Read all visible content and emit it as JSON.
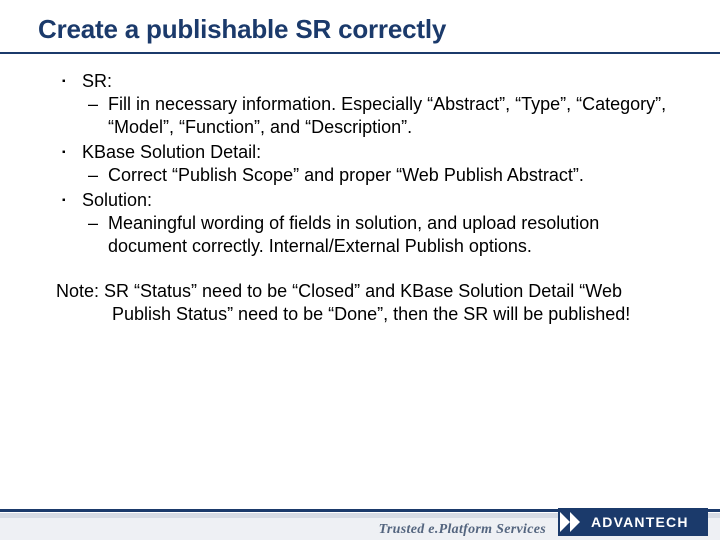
{
  "title": "Create a publishable SR correctly",
  "bullets": [
    {
      "label": "SR:",
      "sub": [
        "Fill in necessary information. Especially “Abstract”, “Type”, “Category”, “Model”, “Function”, and “Description”."
      ]
    },
    {
      "label": "KBase Solution Detail:",
      "sub": [
        "Correct “Publish Scope” and proper “Web Publish Abstract”."
      ]
    },
    {
      "label": "Solution:",
      "sub": [
        "Meaningful wording of fields in solution, and upload resolution document correctly. Internal/External Publish options."
      ]
    }
  ],
  "note": "Note: SR “Status” need to be “Closed” and KBase Solution Detail “Web Publish Status” need to be “Done”, then the SR will be published!",
  "footer": {
    "tagline": "Trusted e.Platform Services",
    "brand": "ADVANTECH"
  },
  "colors": {
    "brand_navy": "#1b3a6b"
  }
}
